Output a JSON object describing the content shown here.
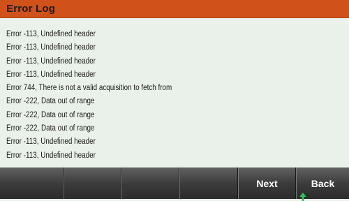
{
  "header": {
    "title": "Error Log"
  },
  "log": {
    "lines": [
      "Error -113, Undefined header",
      "Error -113, Undefined header",
      "Error -113, Undefined header",
      "Error -113, Undefined header",
      "Error 744, There is not a valid acquisition to fetch from",
      "Error -222, Data out of range",
      "Error -222, Data out of range",
      "Error -222, Data out of range",
      "Error -113, Undefined header",
      "Error -113, Undefined header"
    ]
  },
  "softkeys": {
    "key1": "",
    "key2": "",
    "key3": "",
    "key4": "",
    "next_label": "Next",
    "back_label": "Back"
  },
  "colors": {
    "title_bar": "#d0521a",
    "background": "#eaf1ea",
    "softkey": "#3c3c3c",
    "back_indicator": "#2fc35a"
  },
  "icons": {
    "back_indicator": "up-arrow-icon"
  }
}
